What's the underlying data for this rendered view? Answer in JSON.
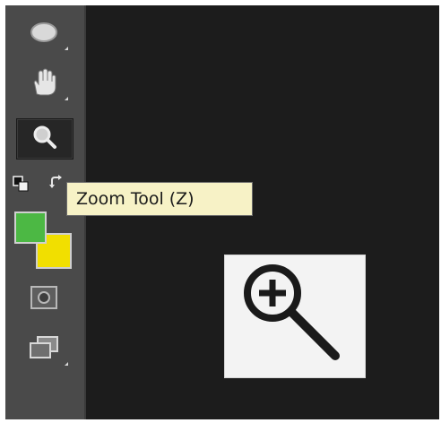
{
  "toolbar": {
    "tools": [
      {
        "icon": "ellipse-marquee-icon",
        "selected": false,
        "has_submenu": true
      },
      {
        "icon": "hand-icon",
        "selected": false,
        "has_submenu": true
      },
      {
        "icon": "zoom-icon",
        "selected": true,
        "has_submenu": false
      },
      {
        "icon": "quick-mask-icon",
        "selected": false,
        "has_submenu": false
      },
      {
        "icon": "screen-mode-icon",
        "selected": false,
        "has_submenu": true
      }
    ],
    "default_colors_icon": "default-colors-icon",
    "swap_colors_icon": "swap-colors-icon",
    "foreground_color": "#4cb844",
    "background_color": "#f1df00"
  },
  "tooltip": {
    "text": "Zoom Tool (Z)"
  },
  "zoom_card": {
    "icon": "zoom-in-icon"
  }
}
